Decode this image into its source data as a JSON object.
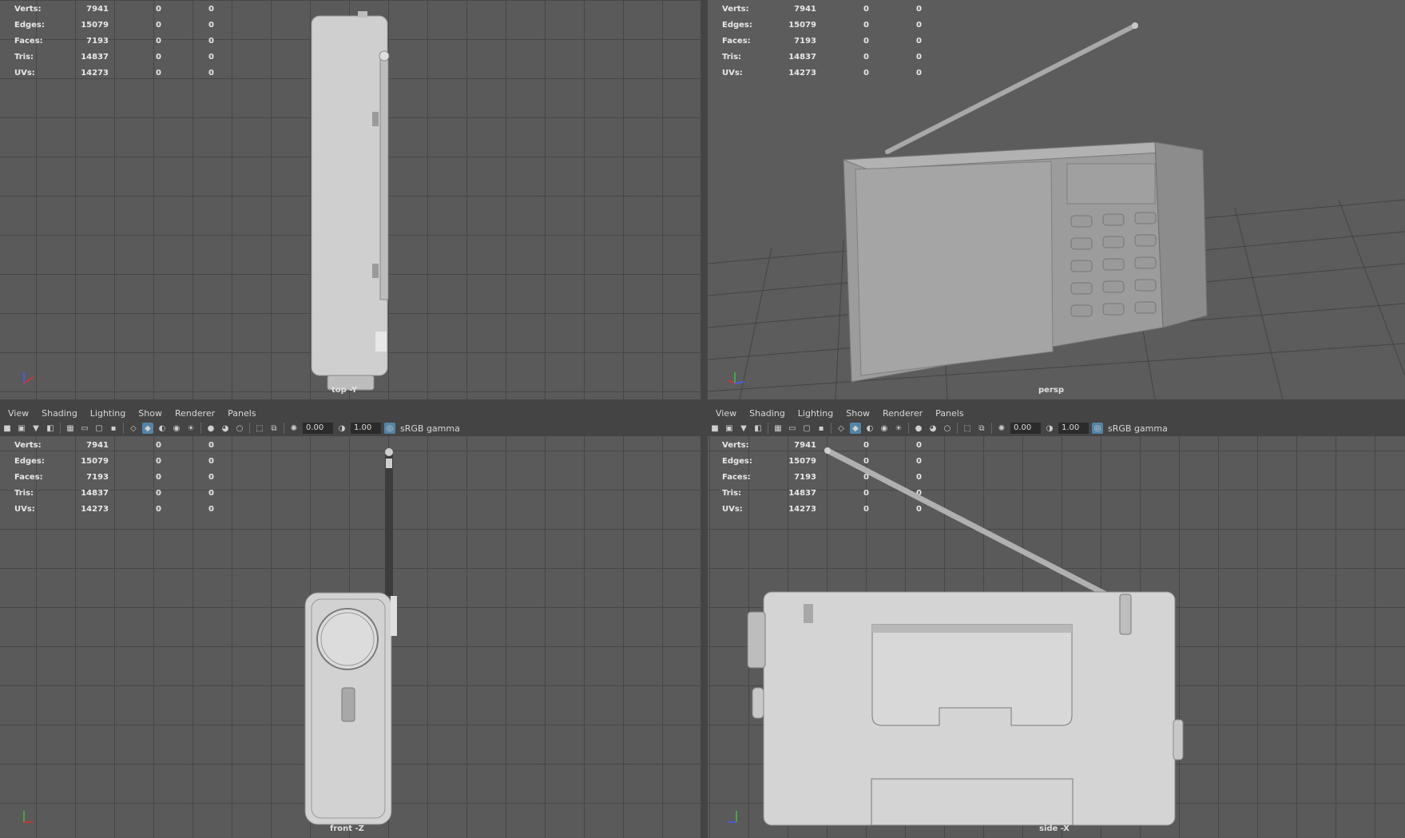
{
  "hud": {
    "rows": [
      {
        "label": "Verts:",
        "v1": "7941",
        "v2": "0",
        "v3": "0"
      },
      {
        "label": "Edges:",
        "v1": "15079",
        "v2": "0",
        "v3": "0"
      },
      {
        "label": "Faces:",
        "v1": "7193",
        "v2": "0",
        "v3": "0"
      },
      {
        "label": "Tris:",
        "v1": "14837",
        "v2": "0",
        "v3": "0"
      },
      {
        "label": "UVs:",
        "v1": "14273",
        "v2": "0",
        "v3": "0"
      }
    ]
  },
  "cameras": {
    "top": "top -Y",
    "persp": "persp",
    "front": "front -Z",
    "side": "side -X"
  },
  "panel_menu": [
    "View",
    "Shading",
    "Lighting",
    "Show",
    "Renderer",
    "Panels"
  ],
  "toolbar": {
    "exposure": "0.00",
    "gamma": "1.00",
    "color_space": "sRGB gamma"
  },
  "colors": {
    "viewport_bg": "#5a5a5a",
    "grid_line": "#474747",
    "model": "#cfcfcf",
    "active_icon": "#5285a6"
  }
}
